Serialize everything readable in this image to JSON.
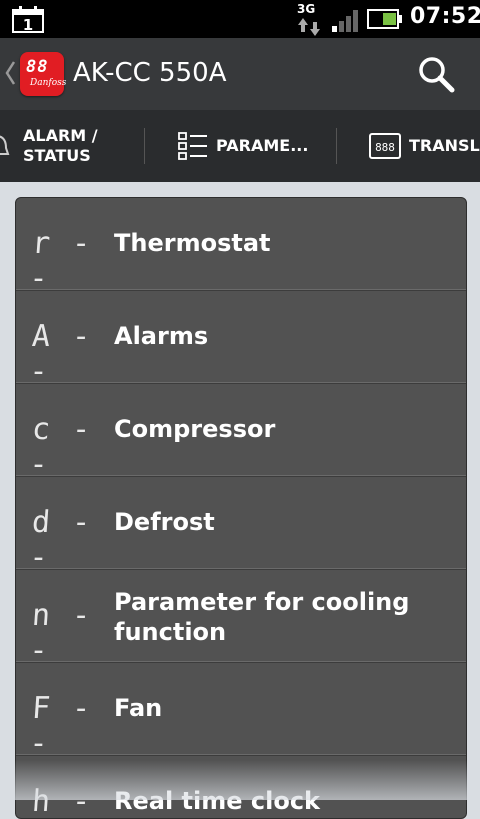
{
  "status_bar": {
    "calendar_day": "1",
    "network": "3G",
    "time": "07:52",
    "battery_color": "#7ac143",
    "icons": [
      "calendar-icon",
      "network-3g-icon",
      "signal-icon",
      "battery-icon"
    ]
  },
  "action_bar": {
    "logo_display": "88",
    "logo_brand": "Danfoss",
    "title": "AK-CC 550A",
    "logo_color": "#e11d23",
    "icons": [
      "back-chevron-icon",
      "search-icon"
    ]
  },
  "tabs": [
    {
      "label": "ALARM / STATUS",
      "icon": "bell-icon"
    },
    {
      "label": "PARAME...",
      "icon": "list-icon",
      "selected": true
    },
    {
      "label": "TRANSLA",
      "icon": "segment-display-icon"
    }
  ],
  "accent_color": "#6a8db8",
  "groups": [
    {
      "code": "r - -",
      "label": "Thermostat"
    },
    {
      "code": "A - -",
      "label": "Alarms"
    },
    {
      "code": "c - -",
      "label": "Compressor"
    },
    {
      "code": "d - -",
      "label": "Defrost"
    },
    {
      "code": "n - -",
      "label": "Parameter for cooling function"
    },
    {
      "code": "F - -",
      "label": "Fan"
    },
    {
      "code": "h - -",
      "label": "Real time clock"
    }
  ]
}
